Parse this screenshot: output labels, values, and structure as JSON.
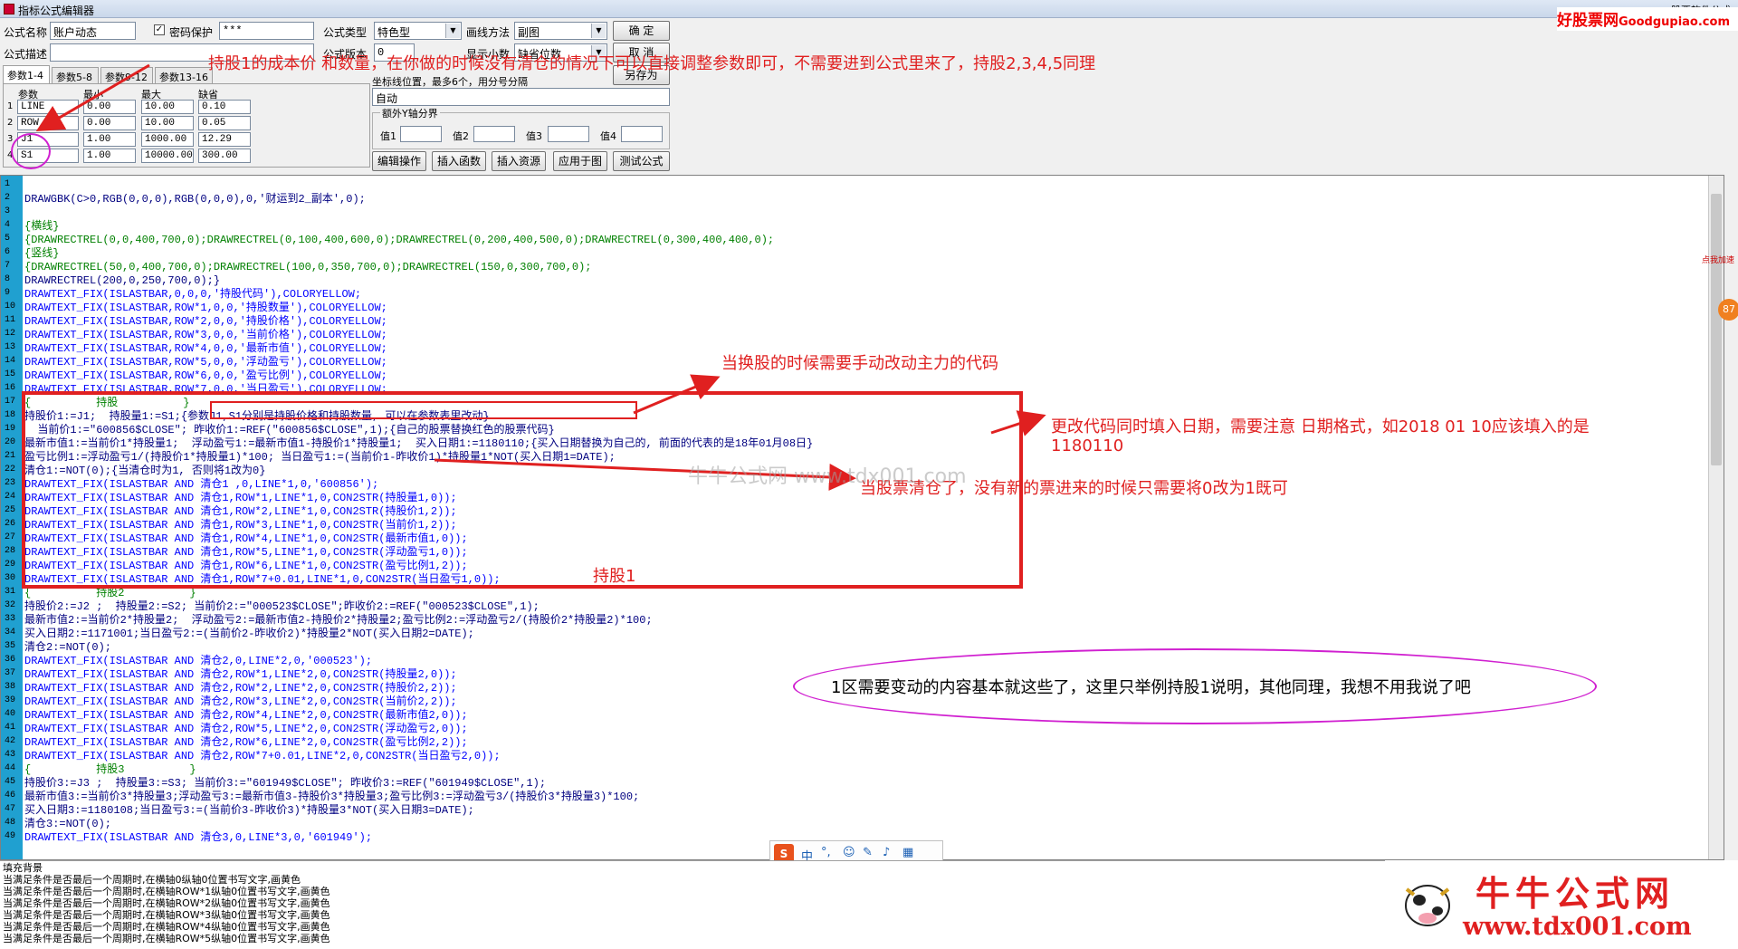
{
  "window": {
    "title": "指标公式编辑器",
    "right_caption": "股票软件公式",
    "menu_ghost": [
      "分析",
      "功能",
      "扩展",
      "系统",
      "帮助"
    ]
  },
  "brand_logo": {
    "cn": "好股票网",
    "en": "Goodgupiao.com"
  },
  "form": {
    "name_label": "公式名称",
    "name_value": "账户动态",
    "pwd_label": "密码保护",
    "pwd_checked": true,
    "pwd_value": "***",
    "type_label": "公式类型",
    "type_value": "特色型",
    "draw_label": "画线方法",
    "draw_value": "副图",
    "ok_label": "确  定",
    "desc_label": "公式描述",
    "desc_value": "",
    "version_label": "公式版本",
    "version_value": "0",
    "show_decimal_label": "显示小数",
    "decimal_value": "缺省位数",
    "cancel_label": "取  消",
    "saveas_label": "另存为",
    "coord_label": "坐标线位置，最多6个，用分号分隔",
    "coord_value": "自动",
    "extra_y_label": "额外Y轴分界",
    "val_labels": [
      "值1",
      "值2",
      "值3",
      "值4"
    ]
  },
  "param_tabs": [
    "参数1-4",
    "参数5-8",
    "参数9-12",
    "参数13-16"
  ],
  "param_table": {
    "headers": [
      "参数",
      "最小",
      "最大",
      "缺省"
    ],
    "rows": [
      {
        "n": "1",
        "name": "LINE",
        "min": "0.00",
        "max": "10.00",
        "def": "0.10"
      },
      {
        "n": "2",
        "name": "ROW",
        "min": "0.00",
        "max": "10.00",
        "def": "0.05"
      },
      {
        "n": "3",
        "name": "J1",
        "min": "1.00",
        "max": "1000.00",
        "def": "12.29"
      },
      {
        "n": "4",
        "name": "S1",
        "min": "1.00",
        "max": "10000.00",
        "def": "300.00"
      }
    ]
  },
  "action_buttons": [
    "编辑操作",
    "插入函数",
    "插入资源",
    "应用于图",
    "测试公式"
  ],
  "code_lines": [
    {
      "n": "1",
      "t": ""
    },
    {
      "n": "2",
      "t": "DRAWGBK(C>0,RGB(0,0,0),RGB(0,0,0),0,'财运到2_副本',0);"
    },
    {
      "n": "3",
      "t": ""
    },
    {
      "n": "4",
      "t": "{横线}"
    },
    {
      "n": "5",
      "t": "{DRAWRECTREL(0,0,400,700,0);DRAWRECTREL(0,100,400,600,0);DRAWRECTREL(0,200,400,500,0);DRAWRECTREL(0,300,400,400,0);"
    },
    {
      "n": "6",
      "t": "{竖线}"
    },
    {
      "n": "7",
      "t": "{DRAWRECTREL(50,0,400,700,0);DRAWRECTREL(100,0,350,700,0);DRAWRECTREL(150,0,300,700,0);"
    },
    {
      "n": "8",
      "t": "DRAWRECTREL(200,0,250,700,0);}"
    },
    {
      "n": "9",
      "t": "DRAWTEXT_FIX(ISLASTBAR,0,0,0,'持股代码'),COLORYELLOW;"
    },
    {
      "n": "10",
      "t": "DRAWTEXT_FIX(ISLASTBAR,ROW*1,0,0,'持股数量'),COLORYELLOW;"
    },
    {
      "n": "11",
      "t": "DRAWTEXT_FIX(ISLASTBAR,ROW*2,0,0,'持股价格'),COLORYELLOW;"
    },
    {
      "n": "12",
      "t": "DRAWTEXT_FIX(ISLASTBAR,ROW*3,0,0,'当前价格'),COLORYELLOW;"
    },
    {
      "n": "13",
      "t": "DRAWTEXT_FIX(ISLASTBAR,ROW*4,0,0,'最新市值'),COLORYELLOW;"
    },
    {
      "n": "14",
      "t": "DRAWTEXT_FIX(ISLASTBAR,ROW*5,0,0,'浮动盈亏'),COLORYELLOW;"
    },
    {
      "n": "15",
      "t": "DRAWTEXT_FIX(ISLASTBAR,ROW*6,0,0,'盈亏比例'),COLORYELLOW;"
    },
    {
      "n": "16",
      "t": "DRAWTEXT_FIX(ISLASTBAR,ROW*7,0,0,'当日盈亏'),COLORYELLOW;"
    },
    {
      "n": "17",
      "t": "{          持股          }"
    },
    {
      "n": "18",
      "t": "持股价1:=J1;  持股量1:=S1;{参数J1,S1分别是持股价格和持股数量, 可以在参数表里改动}"
    },
    {
      "n": "19",
      "t": "  当前价1:=\"600856$CLOSE\"; 昨收价1:=REF(\"600856$CLOSE\",1);{自己的股票替换红色的股票代码}"
    },
    {
      "n": "20",
      "t": "最新市值1:=当前价1*持股量1;  浮动盈亏1:=最新市值1-持股价1*持股量1;  买入日期1:=1180110;{买入日期替换为自己的, 前面的代表的是18年01月08日}"
    },
    {
      "n": "21",
      "t": "盈亏比例1:=浮动盈亏1/(持股价1*持股量1)*100; 当日盈亏1:=(当前价1-昨收价1)*持股量1*NOT(买入日期1=DATE);"
    },
    {
      "n": "22",
      "t": "清仓1:=NOT(0);{当清仓时为1, 否则将1改为0}"
    },
    {
      "n": "23",
      "t": "DRAWTEXT_FIX(ISLASTBAR AND 清仓1 ,0,LINE*1,0,'600856');"
    },
    {
      "n": "24",
      "t": "DRAWTEXT_FIX(ISLASTBAR AND 清仓1,ROW*1,LINE*1,0,CON2STR(持股量1,0));"
    },
    {
      "n": "25",
      "t": "DRAWTEXT_FIX(ISLASTBAR AND 清仓1,ROW*2,LINE*1,0,CON2STR(持股价1,2));"
    },
    {
      "n": "26",
      "t": "DRAWTEXT_FIX(ISLASTBAR AND 清仓1,ROW*3,LINE*1,0,CON2STR(当前价1,2));"
    },
    {
      "n": "27",
      "t": "DRAWTEXT_FIX(ISLASTBAR AND 清仓1,ROW*4,LINE*1,0,CON2STR(最新市值1,0));"
    },
    {
      "n": "28",
      "t": "DRAWTEXT_FIX(ISLASTBAR AND 清仓1,ROW*5,LINE*1,0,CON2STR(浮动盈亏1,0));"
    },
    {
      "n": "29",
      "t": "DRAWTEXT_FIX(ISLASTBAR AND 清仓1,ROW*6,LINE*1,0,CON2STR(盈亏比例1,2));"
    },
    {
      "n": "30",
      "t": "DRAWTEXT_FIX(ISLASTBAR AND 清仓1,ROW*7+0.01,LINE*1,0,CON2STR(当日盈亏1,0));"
    },
    {
      "n": "31",
      "t": "{          持股2          }"
    },
    {
      "n": "32",
      "t": "持股价2:=J2 ;  持股量2:=S2; 当前价2:=\"000523$CLOSE\";昨收价2:=REF(\"000523$CLOSE\",1);"
    },
    {
      "n": "33",
      "t": "最新市值2:=当前价2*持股量2;  浮动盈亏2:=最新市值2-持股价2*持股量2;盈亏比例2:=浮动盈亏2/(持股价2*持股量2)*100;"
    },
    {
      "n": "34",
      "t": "买入日期2:=1171001;当日盈亏2:=(当前价2-昨收价2)*持股量2*NOT(买入日期2=DATE);"
    },
    {
      "n": "35",
      "t": "清仓2:=NOT(0);"
    },
    {
      "n": "36",
      "t": "DRAWTEXT_FIX(ISLASTBAR AND 清仓2,0,LINE*2,0,'000523');"
    },
    {
      "n": "37",
      "t": "DRAWTEXT_FIX(ISLASTBAR AND 清仓2,ROW*1,LINE*2,0,CON2STR(持股量2,0));"
    },
    {
      "n": "38",
      "t": "DRAWTEXT_FIX(ISLASTBAR AND 清仓2,ROW*2,LINE*2,0,CON2STR(持股价2,2));"
    },
    {
      "n": "39",
      "t": "DRAWTEXT_FIX(ISLASTBAR AND 清仓2,ROW*3,LINE*2,0,CON2STR(当前价2,2));"
    },
    {
      "n": "40",
      "t": "DRAWTEXT_FIX(ISLASTBAR AND 清仓2,ROW*4,LINE*2,0,CON2STR(最新市值2,0));"
    },
    {
      "n": "41",
      "t": "DRAWTEXT_FIX(ISLASTBAR AND 清仓2,ROW*5,LINE*2,0,CON2STR(浮动盈亏2,0));"
    },
    {
      "n": "42",
      "t": "DRAWTEXT_FIX(ISLASTBAR AND 清仓2,ROW*6,LINE*2,0,CON2STR(盈亏比例2,2));"
    },
    {
      "n": "43",
      "t": "DRAWTEXT_FIX(ISLASTBAR AND 清仓2,ROW*7+0.01,LINE*2,0,CON2STR(当日盈亏2,0));"
    },
    {
      "n": "44",
      "t": "{          持股3          }"
    },
    {
      "n": "45",
      "t": "持股价3:=J3 ;  持股量3:=S3; 当前价3:=\"601949$CLOSE\"; 昨收价3:=REF(\"601949$CLOSE\",1);"
    },
    {
      "n": "46",
      "t": "最新市值3:=当前价3*持股量3;浮动盈亏3:=最新市值3-持股价3*持股量3;盈亏比例3:=浮动盈亏3/(持股价3*持股量3)*100;"
    },
    {
      "n": "47",
      "t": "买入日期3:=1180108;当日盈亏3:=(当前价3-昨收价3)*持股量3*NOT(买入日期3=DATE);"
    },
    {
      "n": "48",
      "t": "清仓3:=NOT(0);"
    },
    {
      "n": "49",
      "t": "DRAWTEXT_FIX(ISLASTBAR AND 清仓3,0,LINE*3,0,'601949');"
    }
  ],
  "annotations": {
    "top": "持股1的成本价 和数量，在你做的时候没有清仓的情况下可以直接调整参数即可，不需要进到公式里来了，持股2,3,4,5同理",
    "switch": "当换股的时候需要手动改动主力的代码",
    "date_line1": "更改代码同时填入日期，需要注意 日期格式，如2018 01 10应该填入的是",
    "date_line2": "1180110",
    "clear": "当股票清仓了，没有新的票进来的时候只需要将0改为1既可",
    "hold1": "持股1",
    "summary": "1区需要变动的内容基本就这些了，这里只举例持股1说明，其他同理，我想不用我说了吧",
    "watermark": "牛牛公式网 www.tdx001.com"
  },
  "status_lines": [
    "填充背景",
    "当满足条件是否最后一个周期时,在横轴0纵轴0位置书写文字,画黄色",
    "当满足条件是否最后一个周期时,在横轴ROW*1纵轴0位置书写文字,画黄色",
    "当满足条件是否最后一个周期时,在横轴ROW*2纵轴0位置书写文字,画黄色",
    "当满足条件是否最后一个周期时,在横轴ROW*3纵轴0位置书写文字,画黄色",
    "当满足条件是否最后一个周期时,在横轴ROW*4纵轴0位置书写文字,画黄色",
    "当满足条件是否最后一个周期时,在横轴ROW*5纵轴0位置书写文字,画黄色"
  ],
  "niuniu_logo": {
    "title": "牛牛公式网",
    "url": "www.tdx001.com"
  },
  "side_badge": {
    "label": "点我加速",
    "count": "87"
  },
  "ime_bar": {
    "logo": "S",
    "mode": "中"
  },
  "colors": {
    "annotation": "#e02020",
    "gutter": "#20a0d0",
    "ellipse": "#d020d0"
  }
}
